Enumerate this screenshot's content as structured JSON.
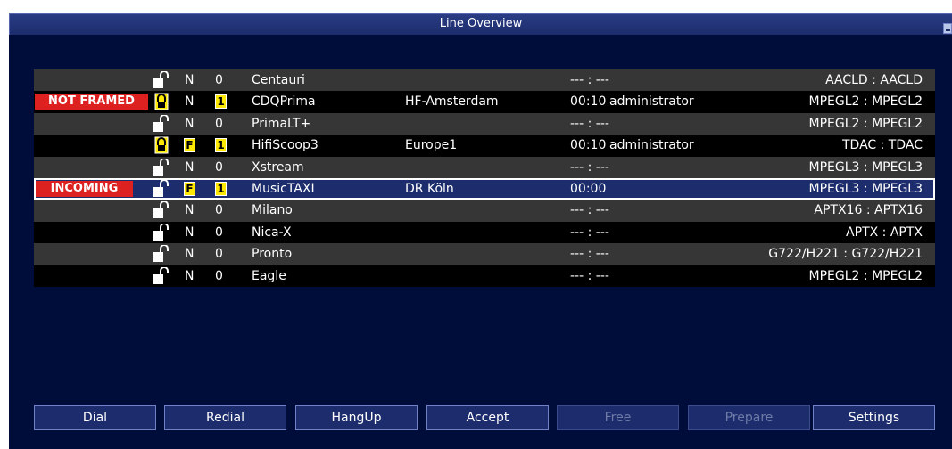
{
  "window": {
    "title": "Line Overview"
  },
  "lines": [
    {
      "status": "",
      "locked": false,
      "type": "N",
      "type_marked": false,
      "count": "0",
      "count_marked": false,
      "name": "Centauri",
      "location": "",
      "time": "--- : ---",
      "user": "",
      "codec": "AACLD : AACLD",
      "selected": false
    },
    {
      "status": "NOT FRAMED",
      "locked": true,
      "type": "N",
      "type_marked": false,
      "count": "1",
      "count_marked": true,
      "name": "CDQPrima",
      "location": "HF-Amsterdam",
      "time": "00:10",
      "user": "administrator",
      "codec": "MPEGL2 : MPEGL2",
      "selected": false
    },
    {
      "status": "",
      "locked": false,
      "type": "N",
      "type_marked": false,
      "count": "0",
      "count_marked": false,
      "name": "PrimaLT+",
      "location": "",
      "time": "--- : ---",
      "user": "",
      "codec": "MPEGL2 : MPEGL2",
      "selected": false
    },
    {
      "status": "",
      "locked": true,
      "type": "F",
      "type_marked": true,
      "count": "1",
      "count_marked": true,
      "name": "HifiScoop3",
      "location": "Europe1",
      "time": "00:10",
      "user": "administrator",
      "codec": "TDAC : TDAC",
      "selected": false
    },
    {
      "status": "",
      "locked": false,
      "type": "N",
      "type_marked": false,
      "count": "0",
      "count_marked": false,
      "name": "Xstream",
      "location": "",
      "time": "--- : ---",
      "user": "",
      "codec": "MPEGL3 : MPEGL3",
      "selected": false
    },
    {
      "status": "INCOMING",
      "locked": false,
      "type": "F",
      "type_marked": true,
      "count": "1",
      "count_marked": true,
      "name": "MusicTAXI",
      "location": "DR Köln",
      "time": "00:00",
      "user": "",
      "codec": "MPEGL3 : MPEGL3",
      "selected": true
    },
    {
      "status": "",
      "locked": false,
      "type": "N",
      "type_marked": false,
      "count": "0",
      "count_marked": false,
      "name": "Milano",
      "location": "",
      "time": "--- : ---",
      "user": "",
      "codec": "APTX16 : APTX16",
      "selected": false
    },
    {
      "status": "",
      "locked": false,
      "type": "N",
      "type_marked": false,
      "count": "0",
      "count_marked": false,
      "name": "Nica-X",
      "location": "",
      "time": "--- : ---",
      "user": "",
      "codec": "APTX : APTX",
      "selected": false
    },
    {
      "status": "",
      "locked": false,
      "type": "N",
      "type_marked": false,
      "count": "0",
      "count_marked": false,
      "name": "Pronto",
      "location": "",
      "time": "--- : ---",
      "user": "",
      "codec": "G722/H221 : G722/H221",
      "selected": false
    },
    {
      "status": "",
      "locked": false,
      "type": "N",
      "type_marked": false,
      "count": "0",
      "count_marked": false,
      "name": "Eagle",
      "location": "",
      "time": "--- : ---",
      "user": "",
      "codec": "MPEGL2 : MPEGL2",
      "selected": false
    }
  ],
  "buttons": [
    {
      "label": "Dial",
      "enabled": true
    },
    {
      "label": "Redial",
      "enabled": true
    },
    {
      "label": "HangUp",
      "enabled": true
    },
    {
      "label": "Accept",
      "enabled": true
    },
    {
      "label": "Free",
      "enabled": false
    },
    {
      "label": "Prepare",
      "enabled": false
    },
    {
      "label": "Settings",
      "enabled": true
    }
  ],
  "colors": {
    "background": "#000d3a",
    "titlebar": "#1c2c6c",
    "row_odd": "#363636",
    "row_even": "#000000",
    "selected_row": "#1c2c6c",
    "badge_red": "#dd2020",
    "marker_yellow": "#ffe800"
  },
  "icons": {
    "lock_open": "padlock-open-icon",
    "lock_closed": "padlock-closed-icon"
  }
}
